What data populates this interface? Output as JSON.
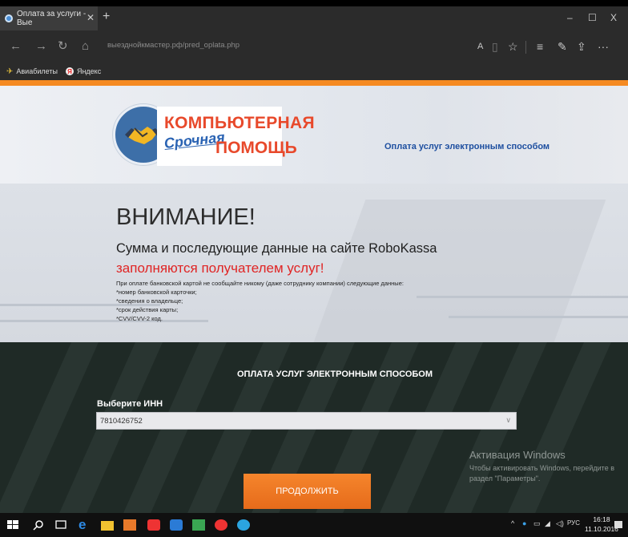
{
  "browser": {
    "tab_title": "Оплата за услуги - Вые",
    "tab_close": "✕",
    "new_tab": "+",
    "url": "выезднойкмастер.рф/pred_oplata.php",
    "window_controls": {
      "minimize": "–",
      "maximize": "☐",
      "close": "X"
    },
    "nav": {
      "back": "←",
      "forward": "→",
      "refresh": "↻",
      "home": "⌂"
    },
    "right_icons": {
      "reader": "A",
      "reading_view": "▯",
      "favorite": "☆",
      "hub": "≡",
      "note": "✎",
      "share": "⇪",
      "more": "···"
    },
    "favorites": [
      {
        "label": "Авиабилеты",
        "icon": "plane-icon"
      },
      {
        "label": "Яндекс",
        "icon": "yandex-icon"
      }
    ]
  },
  "header": {
    "logo_line1": "КОМПЬЮТЕРНАЯ",
    "logo_line2a": "Срочная",
    "logo_line2b": "ПОМОЩЬ",
    "link": "Оплата услуг электронным способом"
  },
  "warning": {
    "title": "ВНИМАНИЕ!",
    "line1": "Сумма и последующие данные на сайте RoboKassa",
    "line2": "заполняются получателем услуг!",
    "details": [
      "При оплате банковской картой не сообщайте никому (даже сотруднику компании) следующие данные:",
      "*номер банковской карточки;",
      "*сведения о владельце;",
      "*срок действия карты;",
      "*CVV/CVV-2 код."
    ]
  },
  "payment": {
    "title": "ОПЛАТА УСЛУГ ЭЛЕКТРОННЫМ СПОСОБОМ",
    "inn_label": "Выберите ИНН",
    "inn_value": "7810426752",
    "continue_label": "ПРОДОЛЖИТЬ"
  },
  "activation": {
    "title": "Активация Windows",
    "text": "Чтобы активировать Windows, перейдите в раздел \"Параметры\"."
  },
  "taskbar": {
    "lang": "РУС",
    "time": "16:18",
    "date": "11.10.2016"
  },
  "colors": {
    "accent_orange": "#f58a22",
    "logo_red": "#e8492b",
    "logo_blue": "#2a63b3",
    "warning_red": "#e02424"
  }
}
